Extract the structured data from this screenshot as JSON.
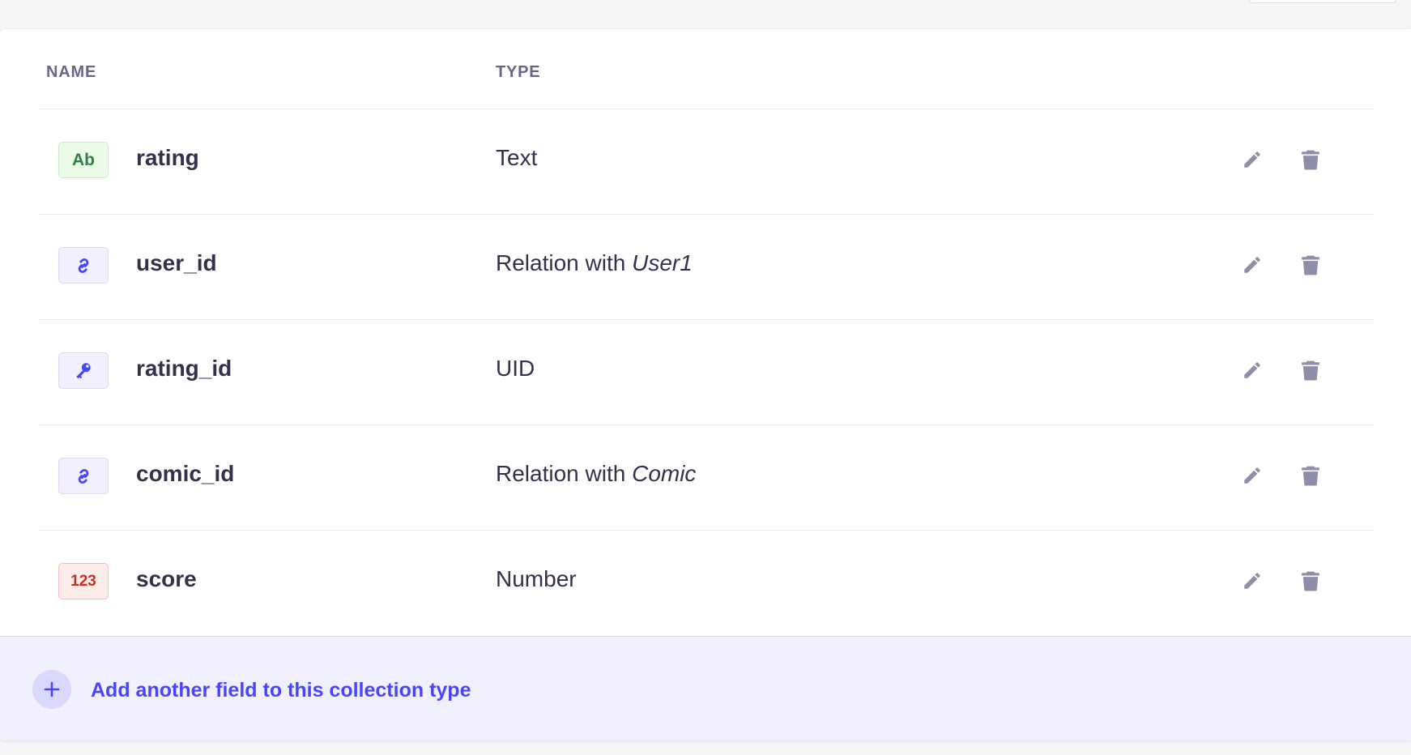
{
  "table": {
    "headers": {
      "name": "NAME",
      "type": "TYPE"
    },
    "rows": [
      {
        "icon_text": "Ab",
        "icon": "text-type-icon",
        "name": "rating",
        "type": "Text",
        "type_target": ""
      },
      {
        "icon_text": "",
        "icon": "relation-link-icon",
        "name": "user_id",
        "type": "Relation with ",
        "type_target": "User1"
      },
      {
        "icon_text": "",
        "icon": "uid-key-icon",
        "name": "rating_id",
        "type": "UID",
        "type_target": ""
      },
      {
        "icon_text": "",
        "icon": "relation-link-icon",
        "name": "comic_id",
        "type": "Relation with ",
        "type_target": "Comic"
      },
      {
        "icon_text": "123",
        "icon": "number-type-icon",
        "name": "score",
        "type": "Number",
        "type_target": ""
      }
    ]
  },
  "footer": {
    "add_label": "Add another field to this collection type",
    "icon": "plus-icon"
  },
  "colors": {
    "accent": "#4945ff",
    "text_primary": "#32324d",
    "text_muted": "#666687",
    "action_icon": "#8e8ea9"
  }
}
